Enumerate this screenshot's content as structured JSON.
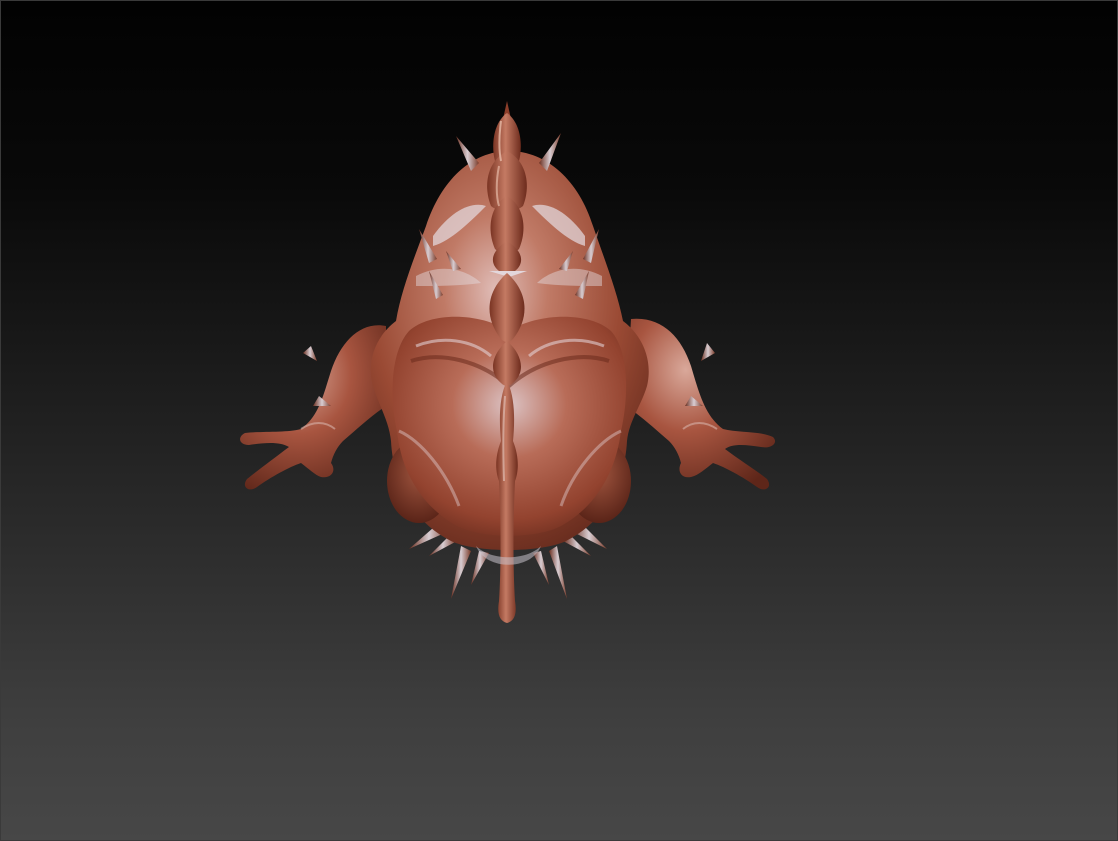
{
  "viewport": {
    "model": "creature-sculpt",
    "material_color": "#9a4a34",
    "highlight_color": "#d9d3dc",
    "shadow_color": "#5a2418",
    "background_top": "#020202",
    "background_bottom": "#474747"
  }
}
